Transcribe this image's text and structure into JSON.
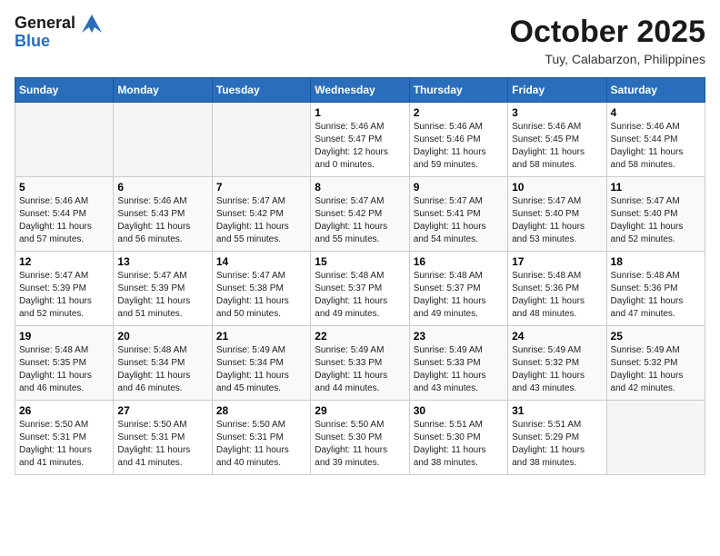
{
  "header": {
    "logo_line1": "General",
    "logo_line2": "Blue",
    "month": "October 2025",
    "location": "Tuy, Calabarzon, Philippines"
  },
  "days_of_week": [
    "Sunday",
    "Monday",
    "Tuesday",
    "Wednesday",
    "Thursday",
    "Friday",
    "Saturday"
  ],
  "weeks": [
    [
      {
        "day": "",
        "info": ""
      },
      {
        "day": "",
        "info": ""
      },
      {
        "day": "",
        "info": ""
      },
      {
        "day": "1",
        "info": "Sunrise: 5:46 AM\nSunset: 5:47 PM\nDaylight: 12 hours\nand 0 minutes."
      },
      {
        "day": "2",
        "info": "Sunrise: 5:46 AM\nSunset: 5:46 PM\nDaylight: 11 hours\nand 59 minutes."
      },
      {
        "day": "3",
        "info": "Sunrise: 5:46 AM\nSunset: 5:45 PM\nDaylight: 11 hours\nand 58 minutes."
      },
      {
        "day": "4",
        "info": "Sunrise: 5:46 AM\nSunset: 5:44 PM\nDaylight: 11 hours\nand 58 minutes."
      }
    ],
    [
      {
        "day": "5",
        "info": "Sunrise: 5:46 AM\nSunset: 5:44 PM\nDaylight: 11 hours\nand 57 minutes."
      },
      {
        "day": "6",
        "info": "Sunrise: 5:46 AM\nSunset: 5:43 PM\nDaylight: 11 hours\nand 56 minutes."
      },
      {
        "day": "7",
        "info": "Sunrise: 5:47 AM\nSunset: 5:42 PM\nDaylight: 11 hours\nand 55 minutes."
      },
      {
        "day": "8",
        "info": "Sunrise: 5:47 AM\nSunset: 5:42 PM\nDaylight: 11 hours\nand 55 minutes."
      },
      {
        "day": "9",
        "info": "Sunrise: 5:47 AM\nSunset: 5:41 PM\nDaylight: 11 hours\nand 54 minutes."
      },
      {
        "day": "10",
        "info": "Sunrise: 5:47 AM\nSunset: 5:40 PM\nDaylight: 11 hours\nand 53 minutes."
      },
      {
        "day": "11",
        "info": "Sunrise: 5:47 AM\nSunset: 5:40 PM\nDaylight: 11 hours\nand 52 minutes."
      }
    ],
    [
      {
        "day": "12",
        "info": "Sunrise: 5:47 AM\nSunset: 5:39 PM\nDaylight: 11 hours\nand 52 minutes."
      },
      {
        "day": "13",
        "info": "Sunrise: 5:47 AM\nSunset: 5:39 PM\nDaylight: 11 hours\nand 51 minutes."
      },
      {
        "day": "14",
        "info": "Sunrise: 5:47 AM\nSunset: 5:38 PM\nDaylight: 11 hours\nand 50 minutes."
      },
      {
        "day": "15",
        "info": "Sunrise: 5:48 AM\nSunset: 5:37 PM\nDaylight: 11 hours\nand 49 minutes."
      },
      {
        "day": "16",
        "info": "Sunrise: 5:48 AM\nSunset: 5:37 PM\nDaylight: 11 hours\nand 49 minutes."
      },
      {
        "day": "17",
        "info": "Sunrise: 5:48 AM\nSunset: 5:36 PM\nDaylight: 11 hours\nand 48 minutes."
      },
      {
        "day": "18",
        "info": "Sunrise: 5:48 AM\nSunset: 5:36 PM\nDaylight: 11 hours\nand 47 minutes."
      }
    ],
    [
      {
        "day": "19",
        "info": "Sunrise: 5:48 AM\nSunset: 5:35 PM\nDaylight: 11 hours\nand 46 minutes."
      },
      {
        "day": "20",
        "info": "Sunrise: 5:48 AM\nSunset: 5:34 PM\nDaylight: 11 hours\nand 46 minutes."
      },
      {
        "day": "21",
        "info": "Sunrise: 5:49 AM\nSunset: 5:34 PM\nDaylight: 11 hours\nand 45 minutes."
      },
      {
        "day": "22",
        "info": "Sunrise: 5:49 AM\nSunset: 5:33 PM\nDaylight: 11 hours\nand 44 minutes."
      },
      {
        "day": "23",
        "info": "Sunrise: 5:49 AM\nSunset: 5:33 PM\nDaylight: 11 hours\nand 43 minutes."
      },
      {
        "day": "24",
        "info": "Sunrise: 5:49 AM\nSunset: 5:32 PM\nDaylight: 11 hours\nand 43 minutes."
      },
      {
        "day": "25",
        "info": "Sunrise: 5:49 AM\nSunset: 5:32 PM\nDaylight: 11 hours\nand 42 minutes."
      }
    ],
    [
      {
        "day": "26",
        "info": "Sunrise: 5:50 AM\nSunset: 5:31 PM\nDaylight: 11 hours\nand 41 minutes."
      },
      {
        "day": "27",
        "info": "Sunrise: 5:50 AM\nSunset: 5:31 PM\nDaylight: 11 hours\nand 41 minutes."
      },
      {
        "day": "28",
        "info": "Sunrise: 5:50 AM\nSunset: 5:31 PM\nDaylight: 11 hours\nand 40 minutes."
      },
      {
        "day": "29",
        "info": "Sunrise: 5:50 AM\nSunset: 5:30 PM\nDaylight: 11 hours\nand 39 minutes."
      },
      {
        "day": "30",
        "info": "Sunrise: 5:51 AM\nSunset: 5:30 PM\nDaylight: 11 hours\nand 38 minutes."
      },
      {
        "day": "31",
        "info": "Sunrise: 5:51 AM\nSunset: 5:29 PM\nDaylight: 11 hours\nand 38 minutes."
      },
      {
        "day": "",
        "info": ""
      }
    ]
  ]
}
